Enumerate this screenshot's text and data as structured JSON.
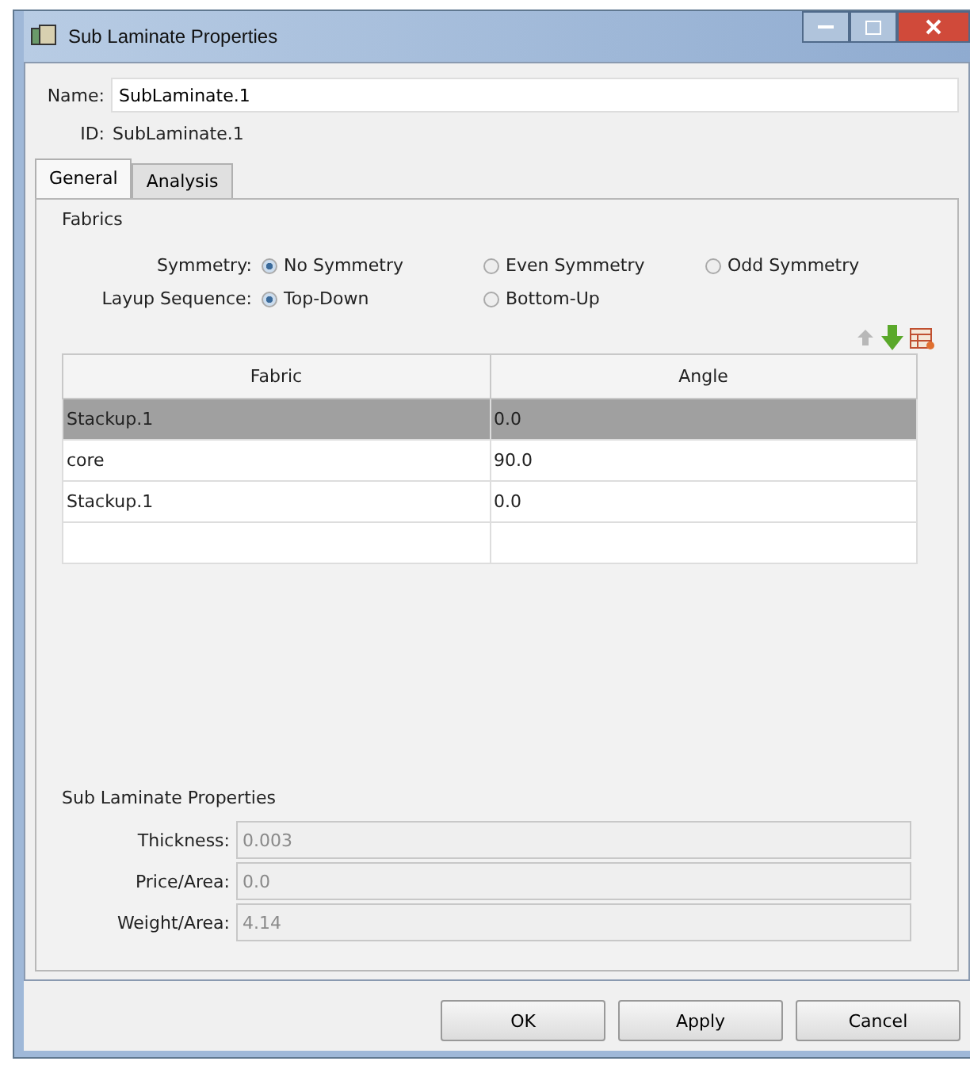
{
  "window": {
    "title": "Sub Laminate Properties"
  },
  "name_field": {
    "label": "Name:",
    "value": "SubLaminate.1"
  },
  "id_field": {
    "label": "ID:",
    "value": "SubLaminate.1"
  },
  "tabs": [
    {
      "label": "General",
      "selected": true
    },
    {
      "label": "Analysis",
      "selected": false
    }
  ],
  "fabrics": {
    "title": "Fabrics",
    "option_groups": [
      {
        "label": "Symmetry:",
        "options": [
          {
            "label": "No Symmetry",
            "selected": true
          },
          {
            "label": "Even Symmetry",
            "selected": false
          },
          {
            "label": "Odd Symmetry",
            "selected": false
          }
        ]
      },
      {
        "label": "Layup Sequence:",
        "options": [
          {
            "label": "Top-Down",
            "selected": true
          },
          {
            "label": "Bottom-Up",
            "selected": false
          }
        ]
      }
    ],
    "table": {
      "columns": [
        "Fabric",
        "Angle"
      ],
      "rows": [
        {
          "cells": [
            "Stackup.1",
            "0.0"
          ],
          "selected": true
        },
        {
          "cells": [
            "core",
            "90.0"
          ],
          "selected": false
        },
        {
          "cells": [
            "Stackup.1",
            "0.0"
          ],
          "selected": false
        },
        {
          "cells": [],
          "selected": false
        }
      ]
    }
  },
  "properties": {
    "title": "Sub Laminate Properties",
    "fields": [
      {
        "label": "Thickness:",
        "value": "0.003",
        "disabled": true
      },
      {
        "label": "Price/Area:",
        "value": "0.0",
        "disabled": true
      },
      {
        "label": "Weight/Area:",
        "value": "4.14",
        "disabled": true
      }
    ]
  },
  "buttons": [
    "OK",
    "Apply",
    "Cancel"
  ]
}
